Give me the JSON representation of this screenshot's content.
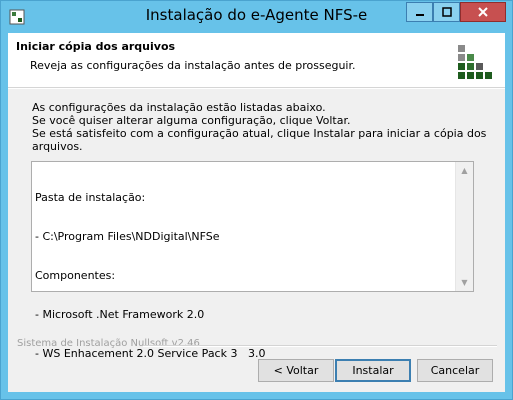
{
  "window": {
    "title": "Instalação do e-Agente NFS-e",
    "icons": {
      "app": "installer-icon",
      "minimize": "minimize-icon",
      "maximize": "maximize-icon",
      "close": "close-icon"
    },
    "colors": {
      "frame": "#67c2e9",
      "close": "#c75050",
      "primary_border": "#3c7fb1"
    }
  },
  "header": {
    "title": "Iniciar cópia dos arquivos",
    "subtitle": "Reveja as configurações da instalação antes de prosseguir.",
    "logo": "nullsoft-installer-logo"
  },
  "description": {
    "lines": [
      "As configurações da instalação estão listadas abaixo.",
      "Se você quiser alterar alguma configuração, clique Voltar.",
      "Se está satisfeito com a configuração atual, clique Instalar para iniciar a cópia dos arquivos."
    ]
  },
  "summary": {
    "lines": [
      "Pasta de instalação:",
      "- C:\\Program Files\\NDDigital\\NFSe",
      "Componentes:",
      "- Microsoft .Net Framework 2.0",
      "- WS Enhacement 2.0 Service Pack 3   3.0"
    ]
  },
  "footer": {
    "branding": "Sistema de Instalação Nullsoft v2.46",
    "back_label": "< Voltar",
    "install_label": "Instalar",
    "cancel_label": "Cancelar"
  }
}
